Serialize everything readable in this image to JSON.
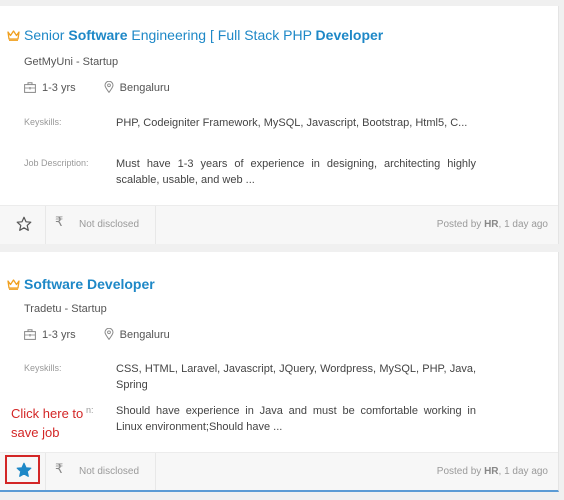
{
  "jobs": [
    {
      "title_parts": [
        {
          "text": "Senior ",
          "bold": false
        },
        {
          "text": "Software",
          "bold": true
        },
        {
          "text": " Engineering [ Full Stack PHP ",
          "bold": false
        },
        {
          "text": "Developer",
          "bold": true
        }
      ],
      "company": "GetMyUni - Startup",
      "experience": "1-3 yrs",
      "location": "Bengaluru",
      "keyskills_label": "Keyskills:",
      "keyskills": "PHP, Codeigniter Framework, MySQL, Javascript, Bootstrap, Html5, C...",
      "description_label": "Job Description:",
      "description": "Must have 1-3 years of experience in designing, architecting highly scalable, usable, and web ...",
      "salary": "Not disclosed",
      "posted_prefix": "Posted by ",
      "posted_by": "HR",
      "posted_suffix": ", 1 day ago",
      "saved": false
    },
    {
      "title_parts": [
        {
          "text": "Software Developer",
          "bold": true
        }
      ],
      "company": "Tradetu - Startup",
      "experience": "1-3 yrs",
      "location": "Bengaluru",
      "keyskills_label": "Keyskills:",
      "keyskills": "CSS, HTML, Laravel, Javascript, JQuery, Wordpress, MySQL, PHP, Java, Spring",
      "description_label": "n:",
      "description": "Should have experience in Java and must be comfortable working in Linux environment;Should have ...",
      "salary": "Not disclosed",
      "posted_prefix": "Posted by ",
      "posted_by": "HR",
      "posted_suffix": ", 1 day ago",
      "saved": true
    }
  ],
  "annotation": {
    "line1": "Click here to",
    "line2": "save job",
    "color": "#d32626"
  },
  "icons": {
    "crown": "crown-icon",
    "briefcase": "briefcase-icon",
    "location": "location-pin-icon",
    "star": "star-icon",
    "rupee": "rupee-icon"
  },
  "colors": {
    "title": "#1e88c7",
    "saved_star": "#1e88c7",
    "crown": "#f0a020"
  }
}
